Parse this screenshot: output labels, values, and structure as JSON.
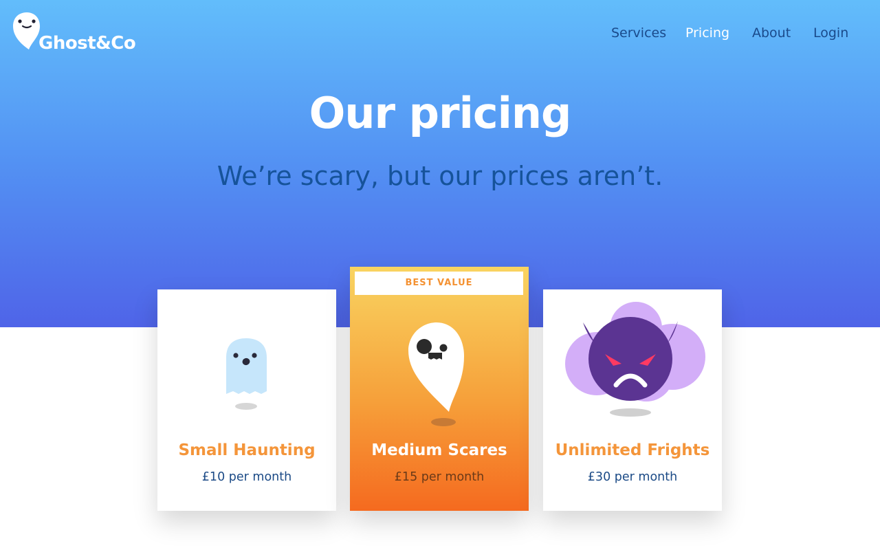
{
  "brand": {
    "name": "Ghost&Co"
  },
  "nav": {
    "items": [
      {
        "label": "Services",
        "active": false
      },
      {
        "label": "Pricing",
        "active": true
      },
      {
        "label": "About",
        "active": false
      },
      {
        "label": "Login",
        "active": false
      }
    ]
  },
  "hero": {
    "title": "Our pricing",
    "subtitle": "We’re scary, but our prices aren’t."
  },
  "plans": [
    {
      "name": "Small Haunting",
      "price": "£10 per month",
      "illustration": "small-ghost-icon"
    },
    {
      "name": "Medium Scares",
      "price": "£15 per month",
      "badge": "BEST VALUE",
      "illustration": "medium-ghost-icon"
    },
    {
      "name": "Unlimited Frights",
      "price": "£30 per month",
      "illustration": "devil-cloud-icon"
    }
  ],
  "colors": {
    "accent_orange": "#f4953a",
    "hero_top": "#62bdfb",
    "hero_bottom": "#4f64e8",
    "navy_text": "#1a4a8b",
    "devil_purple": "#5b3492",
    "cloud_lilac": "#d0aaf7"
  }
}
